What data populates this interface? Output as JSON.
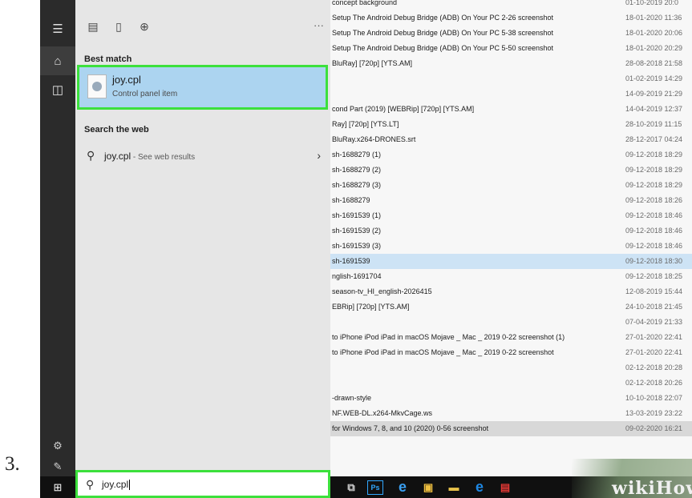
{
  "step_number": "3.",
  "explorer_rows": [
    {
      "name": "concept background",
      "date": "01-10-2019 20:0"
    },
    {
      "name": "Setup The Android Debug Bridge (ADB) On Your PC 2-26 screenshot",
      "date": "18-01-2020 11:36"
    },
    {
      "name": "Setup The Android Debug Bridge (ADB) On Your PC 5-38 screenshot",
      "date": "18-01-2020 20:06"
    },
    {
      "name": "Setup The Android Debug Bridge (ADB) On Your PC 5-50 screenshot",
      "date": "18-01-2020 20:29"
    },
    {
      "name": "BluRay] [720p] [YTS.AM]",
      "date": "28-08-2018 21:58"
    },
    {
      "name": "",
      "date": "01-02-2019 14:29"
    },
    {
      "name": "",
      "date": "14-09-2019 21:29"
    },
    {
      "name": "cond Part (2019) [WEBRip] [720p] [YTS.AM]",
      "date": "14-04-2019 12:37"
    },
    {
      "name": "Ray] [720p] [YTS.LT]",
      "date": "28-10-2019 11:15"
    },
    {
      "name": "BluRay.x264-DRONES.srt",
      "date": "28-12-2017 04:24"
    },
    {
      "name": "sh-1688279 (1)",
      "date": "09-12-2018 18:29"
    },
    {
      "name": "sh-1688279 (2)",
      "date": "09-12-2018 18:29"
    },
    {
      "name": "sh-1688279 (3)",
      "date": "09-12-2018 18:29"
    },
    {
      "name": "sh-1688279",
      "date": "09-12-2018 18:26"
    },
    {
      "name": "sh-1691539 (1)",
      "date": "09-12-2018 18:46"
    },
    {
      "name": "sh-1691539 (2)",
      "date": "09-12-2018 18:46"
    },
    {
      "name": "sh-1691539 (3)",
      "date": "09-12-2018 18:46"
    },
    {
      "name": "sh-1691539",
      "date": "09-12-2018 18:30"
    },
    {
      "name": "nglish-1691704",
      "date": "09-12-2018 18:25"
    },
    {
      "name": "season-tv_HI_english-2026415",
      "date": "12-08-2019 15:44"
    },
    {
      "name": "EBRip] [720p] [YTS.AM]",
      "date": "24-10-2018 21:45"
    },
    {
      "name": "",
      "date": "07-04-2019 21:33"
    },
    {
      "name": "to iPhone iPod iPad in macOS Mojave _ Mac _ 2019 0-22 screenshot (1)",
      "date": "27-01-2020 22:41"
    },
    {
      "name": "to iPhone iPod iPad in macOS Mojave _ Mac _ 2019 0-22 screenshot",
      "date": "27-01-2020 22:41"
    },
    {
      "name": "",
      "date": "02-12-2018 20:28"
    },
    {
      "name": "",
      "date": "02-12-2018 20:26"
    },
    {
      "name": "-drawn-style",
      "date": "10-10-2018 22:07"
    },
    {
      "name": "NF.WEB-DL.x264-MkvCage.ws",
      "date": "13-03-2019 23:22"
    },
    {
      "name": "for Windows 7, 8, and 10 (2020) 0-56 screenshot",
      "date": "09-02-2020 16:21"
    }
  ],
  "panel": {
    "top_icons": [
      "document-list-icon",
      "document-icon",
      "globe-icon"
    ],
    "more_label": "···",
    "best_match_label": "Best match",
    "best_match": {
      "title": "joy.cpl",
      "subtitle": "Control panel item"
    },
    "search_web_label": "Search the web",
    "web_result": {
      "query": "joy.cpl",
      "hint": " - See web results"
    }
  },
  "search_box": {
    "value": "joy.cpl"
  },
  "watermark": "wikiHow",
  "colors": {
    "highlight": "#3ce03c",
    "best_match_bg": "#acd4f0",
    "rail": "#2b2b2b",
    "taskbar": "#101010"
  }
}
